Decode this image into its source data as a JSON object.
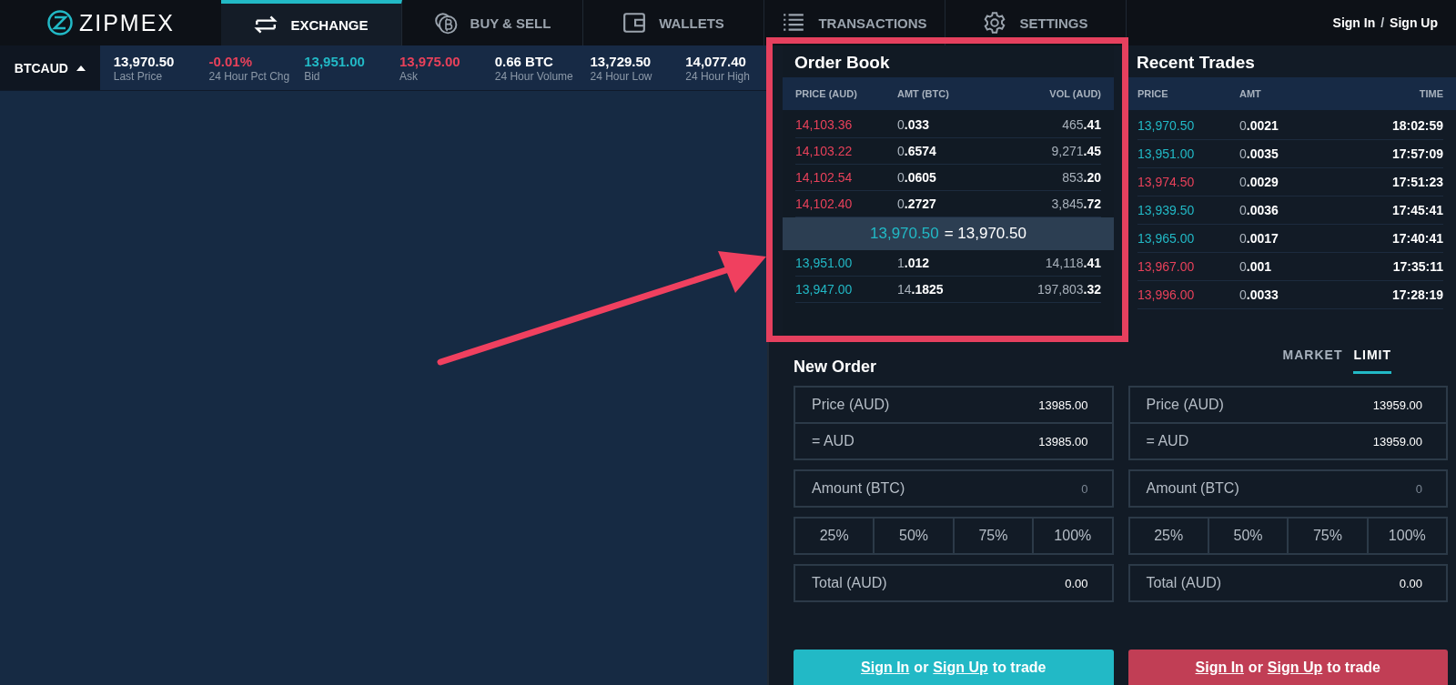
{
  "nav": {
    "logo": "ZIPMEX",
    "tabs": [
      {
        "label": "EXCHANGE",
        "kind": "exchange",
        "selected": true
      },
      {
        "label": "BUY & SELL",
        "kind": "coin",
        "selected": false
      },
      {
        "label": "WALLETS",
        "kind": "wallet",
        "selected": false
      },
      {
        "label": "TRANSACTIONS",
        "kind": "list",
        "selected": false
      },
      {
        "label": "SETTINGS",
        "kind": "gear",
        "selected": false
      }
    ],
    "auth": {
      "sign_in": "Sign In",
      "separator": "/",
      "sign_up": "Sign Up"
    }
  },
  "ticker": {
    "pair": "BTCAUD",
    "stats": [
      {
        "value": "13,970.50",
        "label": "Last Price",
        "color": "#ffffff"
      },
      {
        "value": "-0.01%",
        "label": "24 Hour Pct Chg",
        "color": "#e8415a"
      },
      {
        "value": "13,951.00",
        "label": "Bid",
        "color": "#22b9c6"
      },
      {
        "value": "13,975.00",
        "label": "Ask",
        "color": "#e8415a"
      },
      {
        "value": "0.66 BTC",
        "label": "24 Hour Volume",
        "color": "#ffffff"
      },
      {
        "value": "13,729.50",
        "label": "24 Hour Low",
        "color": "#ffffff"
      },
      {
        "value": "14,077.40",
        "label": "24 Hour High",
        "color": "#ffffff"
      }
    ]
  },
  "order_book": {
    "title": "Order Book",
    "columns": [
      "PRICE (AUD)",
      "AMT (BTC)",
      "VOL (AUD)"
    ],
    "asks": [
      {
        "price": "14,103.36",
        "amount": "0.033",
        "volume": "465.41"
      },
      {
        "price": "14,103.22",
        "amount": "0.6574",
        "volume": "9,271.45"
      },
      {
        "price": "14,102.54",
        "amount": "0.0605",
        "volume": "853.20"
      },
      {
        "price": "14,102.40",
        "amount": "0.2727",
        "volume": "3,845.72"
      }
    ],
    "spread": {
      "last": "13,970.50",
      "separator": "=",
      "value": "13,970.50"
    },
    "bids": [
      {
        "price": "13,951.00",
        "amount": "1.012",
        "volume": "14,118.41"
      },
      {
        "price": "13,947.00",
        "amount": "14.1825",
        "volume": "197,803.32"
      }
    ]
  },
  "recent_trades": {
    "title": "Recent Trades",
    "columns": [
      "PRICE",
      "AMT",
      "TIME"
    ],
    "rows": [
      {
        "price": "13,970.50",
        "amount": "0.0021",
        "time": "18:02:59",
        "color": "#22b9c6"
      },
      {
        "price": "13,951.00",
        "amount": "0.0035",
        "time": "17:57:09",
        "color": "#22b9c6"
      },
      {
        "price": "13,974.50",
        "amount": "0.0029",
        "time": "17:51:23",
        "color": "#e8415a"
      },
      {
        "price": "13,939.50",
        "amount": "0.0036",
        "time": "17:45:41",
        "color": "#22b9c6"
      },
      {
        "price": "13,965.00",
        "amount": "0.0017",
        "time": "17:40:41",
        "color": "#22b9c6"
      },
      {
        "price": "13,967.00",
        "amount": "0.001",
        "time": "17:35:11",
        "color": "#e8415a"
      },
      {
        "price": "13,996.00",
        "amount": "0.0033",
        "time": "17:28:19",
        "color": "#e8415a"
      }
    ]
  },
  "new_order": {
    "title": "New Order",
    "modes": [
      {
        "label": "MARKET",
        "selected": false
      },
      {
        "label": "LIMIT",
        "selected": true
      }
    ],
    "forms": [
      {
        "color": "#22b9c6",
        "price_label": "Price (AUD)",
        "price": "13985.00",
        "equiv_label": "= AUD",
        "equiv": "13985.00",
        "amount_label": "Amount (BTC)",
        "amount_placeholder": "0",
        "percents": [
          "25%",
          "50%",
          "75%",
          "100%"
        ],
        "total_label": "Total (AUD)",
        "total": "0.00",
        "action": {
          "sign_in": "Sign In",
          "or": "or",
          "sign_up": "Sign Up",
          "suffix": "to trade"
        }
      },
      {
        "color": "#c13e55",
        "price_label": "Price (AUD)",
        "price": "13959.00",
        "equiv_label": "= AUD",
        "equiv": "13959.00",
        "amount_label": "Amount (BTC)",
        "amount_placeholder": "0",
        "percents": [
          "25%",
          "50%",
          "75%",
          "100%"
        ],
        "total_label": "Total (AUD)",
        "total": "0.00",
        "action": {
          "sign_in": "Sign In",
          "or": "or",
          "sign_up": "Sign Up",
          "suffix": "to trade"
        }
      }
    ]
  },
  "highlight": {
    "frame": true,
    "arrow": true
  }
}
